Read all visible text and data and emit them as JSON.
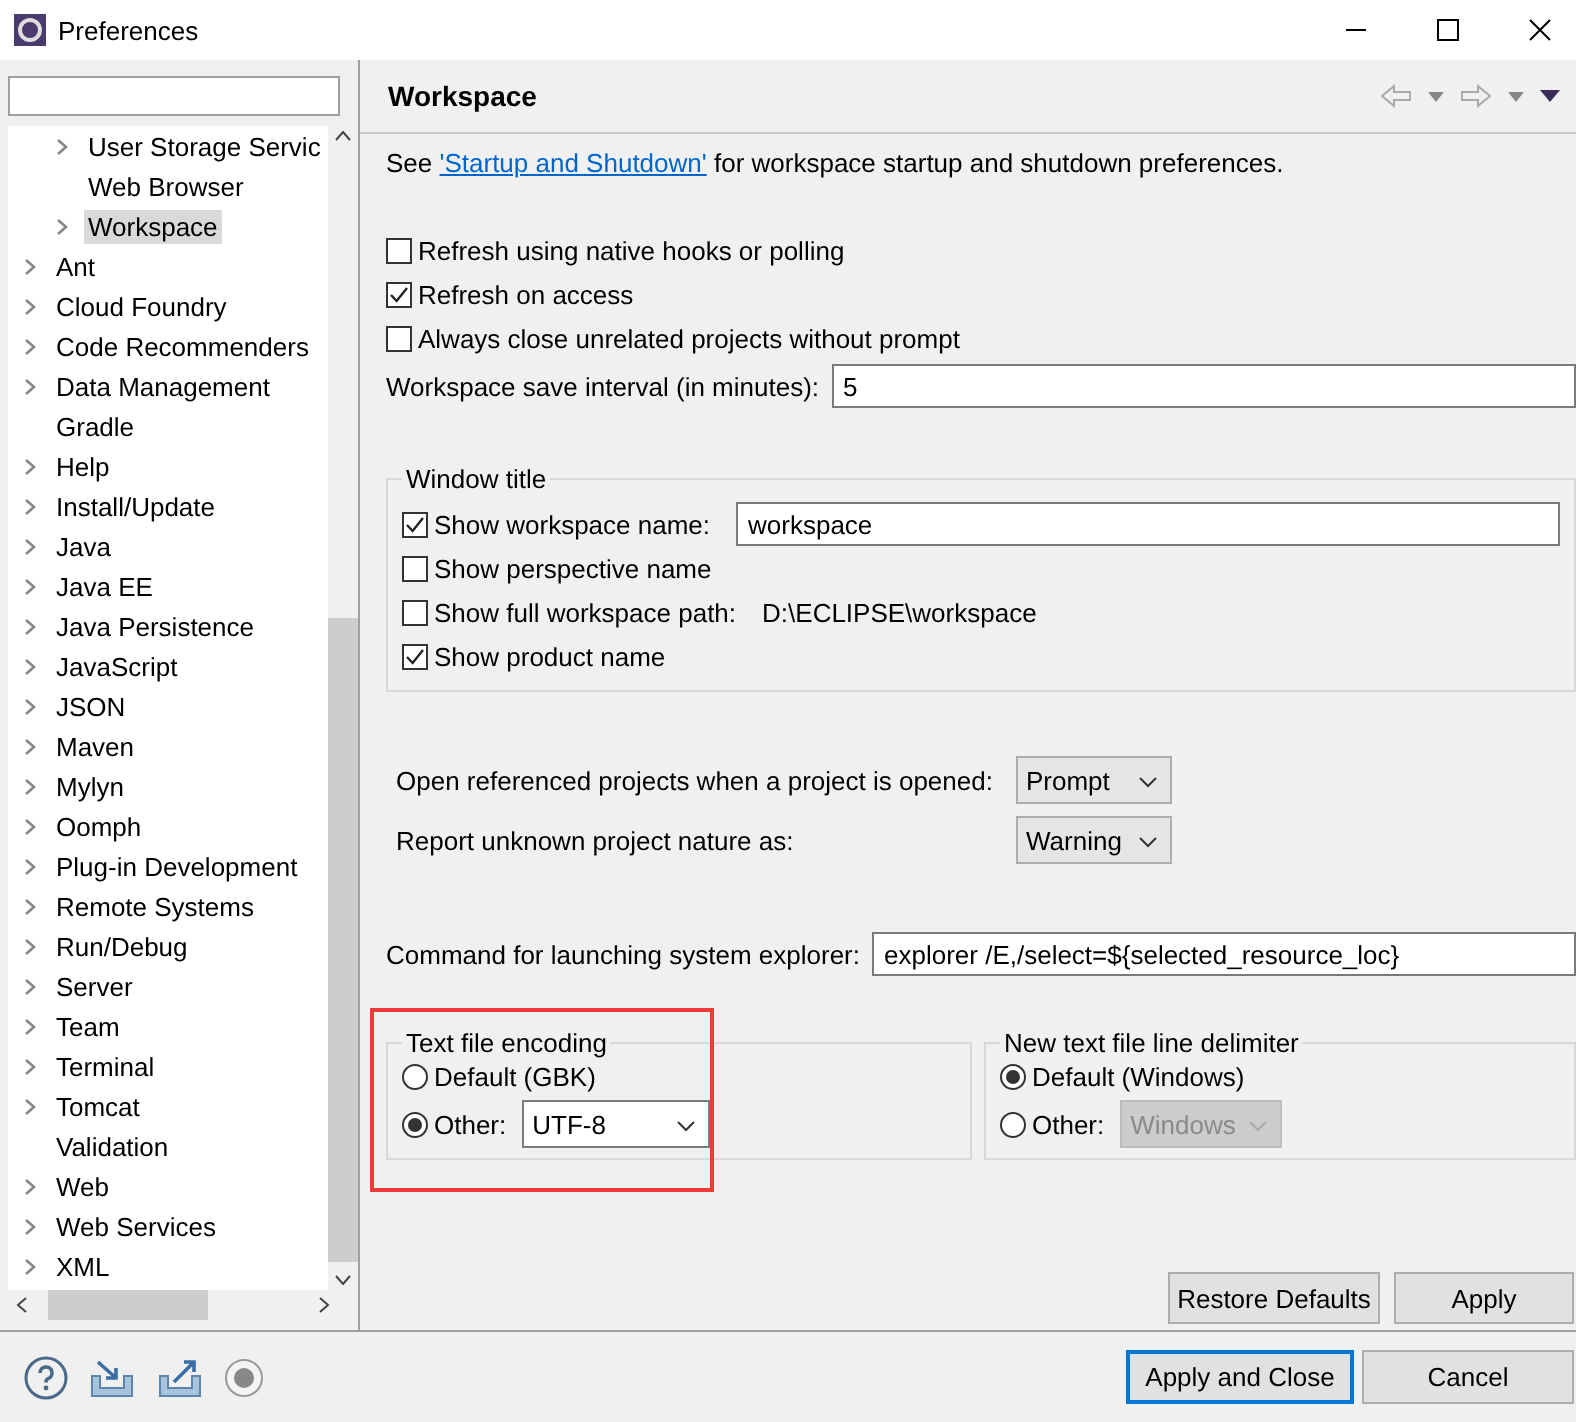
{
  "window": {
    "title": "Preferences"
  },
  "sidebar": {
    "tree": {
      "partial_group": [
        {
          "label": "User Storage Servic",
          "expandable": true,
          "selected": false
        },
        {
          "label": "Web Browser",
          "expandable": false,
          "selected": false
        },
        {
          "label": "Workspace",
          "expandable": true,
          "selected": true
        }
      ],
      "items": [
        {
          "label": "Ant",
          "expandable": true,
          "selected": false
        },
        {
          "label": "Cloud Foundry",
          "expandable": true,
          "selected": false
        },
        {
          "label": "Code Recommenders",
          "expandable": true,
          "selected": false
        },
        {
          "label": "Data Management",
          "expandable": true,
          "selected": false
        },
        {
          "label": "Gradle",
          "expandable": false,
          "selected": false
        },
        {
          "label": "Help",
          "expandable": true,
          "selected": false
        },
        {
          "label": "Install/Update",
          "expandable": true,
          "selected": false
        },
        {
          "label": "Java",
          "expandable": true,
          "selected": false
        },
        {
          "label": "Java EE",
          "expandable": true,
          "selected": false
        },
        {
          "label": "Java Persistence",
          "expandable": true,
          "selected": false
        },
        {
          "label": "JavaScript",
          "expandable": true,
          "selected": false
        },
        {
          "label": "JSON",
          "expandable": true,
          "selected": false
        },
        {
          "label": "Maven",
          "expandable": true,
          "selected": false
        },
        {
          "label": "Mylyn",
          "expandable": true,
          "selected": false
        },
        {
          "label": "Oomph",
          "expandable": true,
          "selected": false
        },
        {
          "label": "Plug-in Development",
          "expandable": true,
          "selected": false
        },
        {
          "label": "Remote Systems",
          "expandable": true,
          "selected": false
        },
        {
          "label": "Run/Debug",
          "expandable": true,
          "selected": false
        },
        {
          "label": "Server",
          "expandable": true,
          "selected": false
        },
        {
          "label": "Team",
          "expandable": true,
          "selected": false
        },
        {
          "label": "Terminal",
          "expandable": true,
          "selected": false
        },
        {
          "label": "Tomcat",
          "expandable": true,
          "selected": false
        },
        {
          "label": "Validation",
          "expandable": false,
          "selected": false
        },
        {
          "label": "Web",
          "expandable": true,
          "selected": false
        },
        {
          "label": "Web Services",
          "expandable": true,
          "selected": false
        },
        {
          "label": "XML",
          "expandable": true,
          "selected": false
        }
      ]
    }
  },
  "page": {
    "title": "Workspace",
    "intro": {
      "before": "See ",
      "link": "'Startup and Shutdown'",
      "after": " for workspace startup and shutdown preferences."
    },
    "checkboxes": [
      {
        "label": "Refresh using native hooks or polling",
        "checked": false
      },
      {
        "label": "Refresh on access",
        "checked": true
      },
      {
        "label": "Always close unrelated projects without prompt",
        "checked": false
      }
    ],
    "save_interval": {
      "label": "Workspace save interval (in minutes):",
      "value": "5"
    },
    "window_title": {
      "title": "Window title",
      "options": [
        {
          "kind": "field",
          "label": "Show workspace name:",
          "checked": true,
          "value": "workspace"
        },
        {
          "kind": "plain",
          "label": "Show perspective name",
          "checked": false
        },
        {
          "kind": "text",
          "label": "Show full workspace path:",
          "checked": false,
          "value": "D:\\ECLIPSE\\workspace"
        },
        {
          "kind": "plain",
          "label": "Show product name",
          "checked": true
        }
      ]
    },
    "dropdowns": [
      {
        "label": "Open referenced projects when a project is opened:",
        "value": "Prompt"
      },
      {
        "label": "Report unknown project nature as:",
        "value": "Warning"
      }
    ],
    "command": {
      "label": "Command for launching system explorer:",
      "value": "explorer /E,/select=${selected_resource_loc}"
    },
    "groups": [
      {
        "title": "Text file encoding",
        "highlighted": true,
        "options": [
          {
            "label": "Default (GBK)",
            "selected": false
          },
          {
            "label": "Other:",
            "selected": true,
            "value": "UTF-8",
            "disabled": false
          }
        ]
      },
      {
        "title": "New text file line delimiter",
        "highlighted": false,
        "options": [
          {
            "label": "Default (Windows)",
            "selected": true
          },
          {
            "label": "Other:",
            "selected": false,
            "value": "Windows",
            "disabled": true
          }
        ]
      }
    ],
    "buttons": [
      "Restore Defaults",
      "Apply"
    ]
  },
  "footer": {
    "buttons": [
      {
        "label": "Apply and Close",
        "default": true
      },
      {
        "label": "Cancel",
        "default": false
      }
    ]
  }
}
